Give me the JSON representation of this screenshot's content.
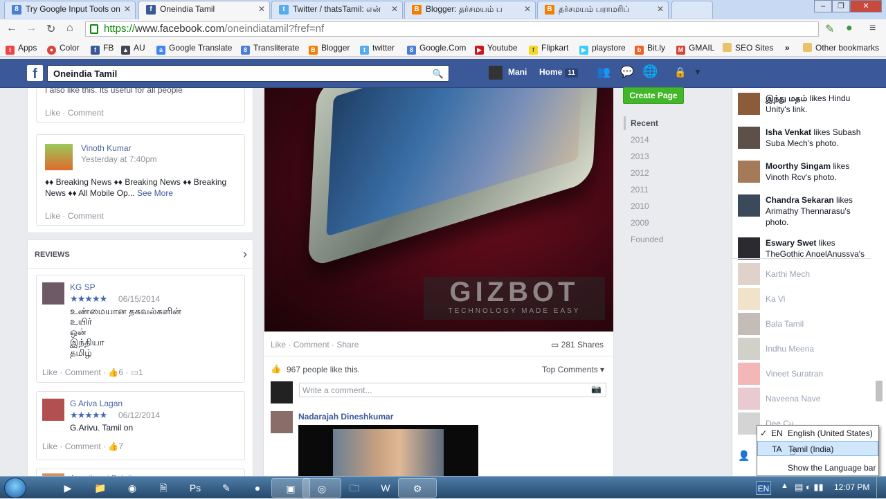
{
  "browser": {
    "tabs": [
      {
        "title": "Try Google Input Tools on",
        "icon": "google-g-icon",
        "color": "#4a7fd8"
      },
      {
        "title": "Oneindia Tamil",
        "icon": "facebook-icon",
        "color": "#3b5998",
        "active": true
      },
      {
        "title": "Twitter / thatsTamil: என்",
        "icon": "twitter-icon",
        "color": "#55acee"
      },
      {
        "title": "Blogger: தர்சமயம் ப",
        "icon": "blogger-icon",
        "color": "#f57d00"
      },
      {
        "title": "தர்சமயம் பராமரிப்",
        "icon": "blogger-icon",
        "color": "#f57d00"
      }
    ],
    "url_scheme": "https://",
    "url_host": "www.facebook.com",
    "url_path": "/oneindiatamil?fref=nf",
    "bookmarks": [
      {
        "label": "Apps",
        "icon": "apps-grid-icon",
        "color": "#e44"
      },
      {
        "label": "Color",
        "icon": "chrome-icon",
        "color": "#db4437"
      },
      {
        "label": "FB",
        "icon": "facebook-icon",
        "color": "#3b5998"
      },
      {
        "label": "AU",
        "icon": "university-icon",
        "color": "#445"
      },
      {
        "label": "Google Translate",
        "icon": "translate-icon",
        "color": "#4285f4"
      },
      {
        "label": "Transliterate",
        "icon": "google-g-icon",
        "color": "#4a7fd8"
      },
      {
        "label": "Blogger",
        "icon": "blogger-icon",
        "color": "#f57d00"
      },
      {
        "label": "twitter",
        "icon": "twitter-icon",
        "color": "#55acee"
      },
      {
        "label": "Google.Com",
        "icon": "google-g-icon",
        "color": "#4a7fd8"
      },
      {
        "label": "Youtube",
        "icon": "youtube-icon",
        "color": "#cc181e"
      },
      {
        "label": "Flipkart",
        "icon": "flipkart-icon",
        "color": "#f8d71c"
      },
      {
        "label": "playstore",
        "icon": "playstore-icon",
        "color": "#3bccff"
      },
      {
        "label": "Bit.ly",
        "icon": "bitly-icon",
        "color": "#ee6123"
      },
      {
        "label": "GMAIL",
        "icon": "gmail-icon",
        "color": "#d44638"
      },
      {
        "label": "SEO Sites",
        "icon": "folder-icon",
        "color": "#e8c36a"
      }
    ],
    "bookmarks_more": "»",
    "other_bookmarks": "Other bookmarks"
  },
  "facebook": {
    "search_value": "Oneindia Tamil",
    "user_name": "Mani",
    "home_label": "Home",
    "home_count": "11",
    "create_page": "Create Page"
  },
  "left": {
    "comment1_text": "I also like this. Its useful for all people",
    "actions_like": "Like",
    "actions_comment": "Comment",
    "post_author": "Vinoth Kumar",
    "post_time": "Yesterday at 7:40pm",
    "post_text": "♦♦ Breaking News ♦♦ Breaking News ♦♦ Breaking News ♦♦ All Mobile Op...",
    "see_more": "See More",
    "reviews_title": "REVIEWS",
    "reviews": [
      {
        "name": "KG SP",
        "stars": "★★★★★",
        "date": "06/15/2014",
        "lines": [
          "உண்மையான தகவல்களின்",
          "உயிர்",
          "ஒன்",
          "இந்தியா",
          "தமிழ்"
        ],
        "likes": "6",
        "comments": "1"
      },
      {
        "name": "G Ariva Lagan",
        "stars": "★★★★★",
        "date": "06/12/2014",
        "lines": [
          "G.Arivu. Tamil on"
        ],
        "likes": "7"
      },
      {
        "name": "Ayyathurai Balaji"
      }
    ]
  },
  "center": {
    "watermark": "GIZBOT",
    "watermark_sub": "TECHNOLOGY MADE EASY",
    "action_like": "Like",
    "action_comment": "Comment",
    "action_share": "Share",
    "shares": "281 Shares",
    "likes": "967 people like this.",
    "top_comments": "Top Comments ▾",
    "comment_placeholder": "Write a comment...",
    "commenter": "Nadarajah Dineshkumar"
  },
  "timeline": {
    "items": [
      "Recent",
      "2014",
      "2013",
      "2012",
      "2011",
      "2010",
      "2009",
      "Founded"
    ]
  },
  "ticker": {
    "items": [
      {
        "name": "இந்து மதம்",
        "text": " likes Hindu Unity's link."
      },
      {
        "name": "Isha Venkat",
        "text": " likes Subash Suba Mech's photo."
      },
      {
        "name": "Moorthy Singam",
        "text": " likes Vinoth Rcv's photo."
      },
      {
        "name": "Chandra Sekaran",
        "text": " likes Arimathy Thennarasu's photo."
      },
      {
        "name": "Eswary Swet",
        "text": " likes TheGothic AngelAnussya's"
      }
    ],
    "chat": [
      "Karthi Mech",
      "Ka Vi",
      "Bala Tamil",
      "Indhu Meena",
      "Vineet Suratran",
      "Naveena Nave",
      "Dee Cu"
    ]
  },
  "language_bar": {
    "en_code": "EN",
    "en_label": "English (United States)",
    "ta_code": "TA",
    "ta_label": "Tamil (India)",
    "show": "Show the Language bar",
    "tray_code": "EN"
  },
  "taskbar": {
    "clock": "12:07 PM"
  }
}
